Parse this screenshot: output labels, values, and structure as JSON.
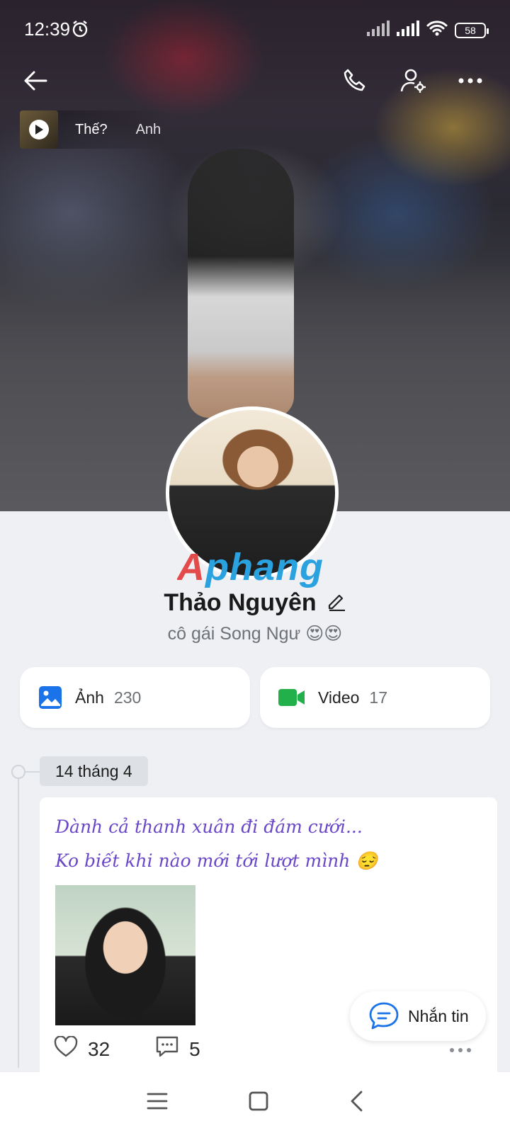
{
  "status_bar": {
    "time": "12:39",
    "battery": "58"
  },
  "story": {
    "title": "Thế?",
    "label": "Anh"
  },
  "profile": {
    "name": "Thảo Nguyên",
    "bio": "cô gái Song Ngư 😍😍"
  },
  "watermark": "Aphang",
  "media": {
    "photos": {
      "label": "Ảnh",
      "count": "230"
    },
    "videos": {
      "label": "Video",
      "count": "17"
    }
  },
  "timeline": {
    "date": "14 tháng 4",
    "post": {
      "line1": "Dành cả thanh xuân đi đám cưới...",
      "line2": "Ko biết khi nào mới tới lượt mình 😔",
      "likes": "32",
      "comments": "5"
    }
  },
  "message_button": {
    "label": "Nhắn tin"
  },
  "colors": {
    "accent": "#1a73e8",
    "video_green": "#22b04b",
    "post_text": "#6a47c8"
  }
}
